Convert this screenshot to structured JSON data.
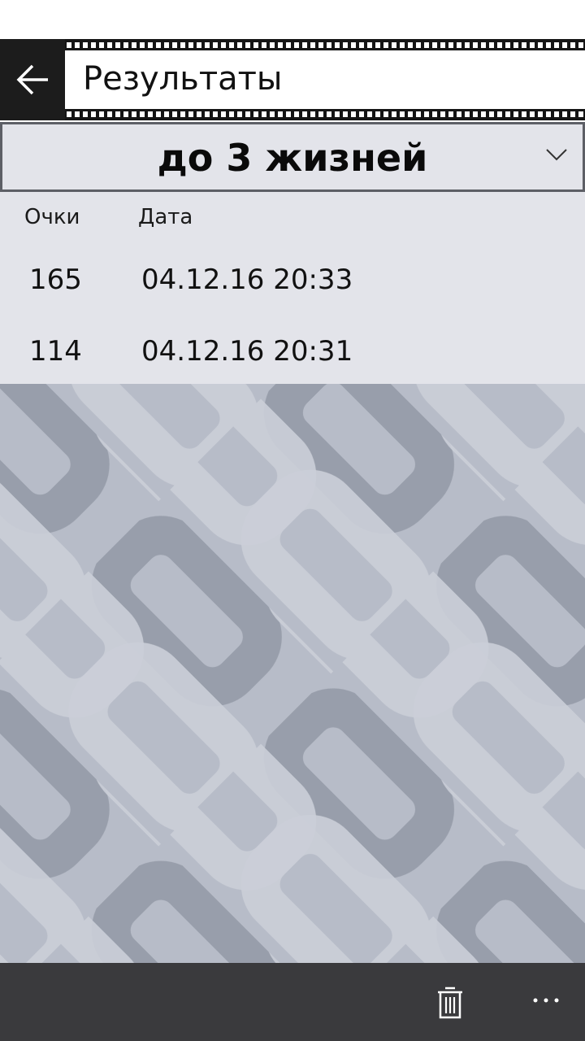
{
  "header": {
    "title": "Результаты",
    "back_icon": "arrow-left-icon"
  },
  "mode_selector": {
    "selected": "до 3 жизней",
    "icon": "chevron-down-icon"
  },
  "results_table": {
    "columns": [
      "Очки",
      "Дата"
    ],
    "rows": [
      {
        "score": "165",
        "date": "04.12.16 20:33"
      },
      {
        "score": "114",
        "date": "04.12.16 20:31"
      }
    ]
  },
  "app_bar": {
    "icons": [
      "trash-icon",
      "more-icon"
    ]
  },
  "colors": {
    "header_bg": "#151515",
    "panel_bg": "#e3e4ea",
    "border": "#5d5f66",
    "pattern_light": "#cfd3dc",
    "pattern_dark": "#8d93a0",
    "app_bar_bg": "#2b2b2e"
  }
}
